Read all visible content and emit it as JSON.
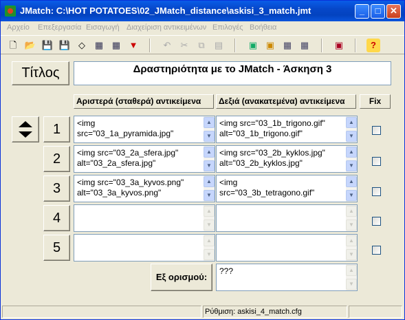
{
  "window": {
    "title": "JMatch: C:\\HOT POTATOES\\02_JMatch_distance\\askisi_3_match.jmt",
    "min_glyph": "_",
    "max_glyph": "□",
    "close_glyph": "✕"
  },
  "menu": [
    "Αρχείο",
    "Επεξεργασία",
    "Εισαγωγή",
    "Διαχείριση αντικειμένων",
    "Επιλογές",
    "Βοήθεια"
  ],
  "toolbar": {
    "icons": [
      {
        "name": "new-icon",
        "glyph": "🗋"
      },
      {
        "name": "open-icon",
        "glyph": "📂"
      },
      {
        "name": "save-icon",
        "glyph": "💾"
      },
      {
        "name": "save-as-icon",
        "glyph": "💾"
      },
      {
        "name": "eraser-icon",
        "glyph": "◇"
      },
      {
        "name": "web-page-icon",
        "glyph": "▦"
      },
      {
        "name": "drag-drop-icon",
        "glyph": "▦"
      },
      {
        "name": "down-arrow-icon",
        "glyph": "▼"
      },
      {
        "name": "undo-icon",
        "glyph": "↶"
      },
      {
        "name": "cut-icon",
        "glyph": "✂"
      },
      {
        "name": "copy-icon",
        "glyph": "⧉"
      },
      {
        "name": "paste-icon",
        "glyph": "▤"
      },
      {
        "name": "image-icon",
        "glyph": "▣"
      },
      {
        "name": "config-icon",
        "glyph": "▣"
      },
      {
        "name": "grid-icon",
        "glyph": "▦"
      },
      {
        "name": "grid2-icon",
        "glyph": "▦"
      },
      {
        "name": "monitor-icon",
        "glyph": "▣"
      },
      {
        "name": "help-icon",
        "glyph": "?"
      }
    ]
  },
  "title_label": "Τίτλος",
  "title_value": "Δραστηριότητα με το JMatch - Άσκηση 3",
  "columns": {
    "left": "Αριστερά (σταθερά) αντικείμενα",
    "right": "Δεξιά (ανακατεμένα) αντικείμενα",
    "fix": "Fix"
  },
  "rows": [
    {
      "num": "1",
      "left": "<img\nsrc=\"03_1a_pyramida.jpg\"",
      "right": "<img src=\"03_1b_trigono.gif\"\nalt=\"03_1b_trigono.gif\""
    },
    {
      "num": "2",
      "left": "<img src=\"03_2a_sfera.jpg\"\nalt=\"03_2a_sfera.jpg\"",
      "right": "<img src=\"03_2b_kyklos.jpg\"\nalt=\"03_2b_kyklos.jpg\""
    },
    {
      "num": "3",
      "left": "<img src=\"03_3a_kyvos.png\"\nalt=\"03_3a_kyvos.png\"",
      "right": "<img\nsrc=\"03_3b_tetragono.gif\""
    },
    {
      "num": "4",
      "left": "",
      "right": ""
    },
    {
      "num": "5",
      "left": "",
      "right": ""
    }
  ],
  "distractor_label": "Εξ ορισμού:",
  "distractor_value": "???",
  "status": {
    "left": "",
    "config": "Ρύθμιση: askisi_4_match.cfg",
    "right": ""
  }
}
